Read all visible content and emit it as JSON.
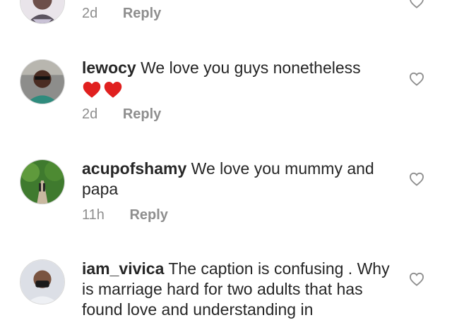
{
  "comments": [
    {
      "username": "",
      "text": "",
      "time": "2d",
      "reply_label": "Reply"
    },
    {
      "username": "lewocy",
      "text": "We love you guys nonetheless",
      "emojis": [
        "red-heart",
        "red-heart"
      ],
      "time": "2d",
      "reply_label": "Reply"
    },
    {
      "username": "acupofshamy",
      "text": "We love you mummy and papa",
      "time": "11h",
      "reply_label": "Reply"
    },
    {
      "username": "iam_vivica",
      "text": "The caption is confusing . Why is marriage hard for two adults that has found love and understanding in",
      "time": "",
      "reply_label": ""
    }
  ],
  "colors": {
    "text": "#262626",
    "meta": "#8e8e8e",
    "heart_outline": "#8e8e8e",
    "emoji_heart": "#e0201f"
  },
  "icons": [
    "like-heart-outline-icon",
    "red-heart-emoji"
  ]
}
